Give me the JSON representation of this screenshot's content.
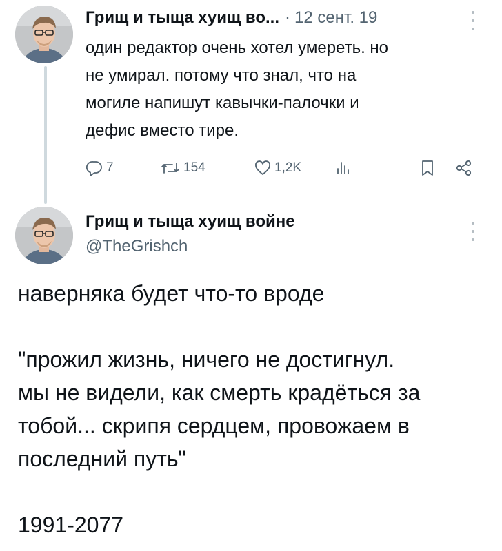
{
  "tweet1": {
    "author_name": "Грищ и тыща хуищ во...",
    "separator": "·",
    "date": "12 сент. 19",
    "text": "один редактор очень хотел умереть. но\nне умирал. потому что знал, что на\nмогиле напишут кавычки-палочки и\nдефис вместо тире.",
    "actions": {
      "replies": "7",
      "retweets": "154",
      "likes": "1,2K",
      "views": ""
    },
    "icons": [
      "comment-icon",
      "retweet-icon",
      "heart-icon",
      "stats-icon",
      "bookmark-icon",
      "share-icon",
      "more-icon"
    ]
  },
  "tweet2": {
    "author_name": "Грищ и тыща хуищ войне",
    "handle": "@TheGrishch",
    "text": "наверняка будет что-то вроде\n\n\"прожил жизнь, ничего не достигнул.\nмы не видели, как смерть крадёться за\nтобой... скрипя сердцем, провожаем в\nпоследний путь\"\n\n1991-2077",
    "icons": [
      "more-icon"
    ]
  },
  "colors": {
    "text": "#0f1419",
    "secondary": "#536471",
    "thread_line": "#cfd9de"
  }
}
